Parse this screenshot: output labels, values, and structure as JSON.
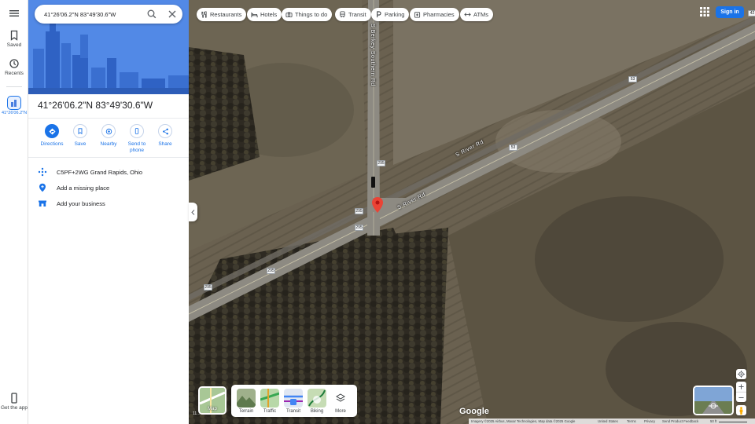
{
  "search": {
    "value": "41°26'06.2\"N 83°49'30.6\"W"
  },
  "rail": {
    "saved": "Saved",
    "recents": "Recents",
    "place_label": "41°26'06.2\"N",
    "get_app": "Get the app"
  },
  "place": {
    "title": "41°26'06.2\"N 83°49'30.6\"W",
    "actions": [
      {
        "label": "Directions",
        "icon": "directions-icon"
      },
      {
        "label": "Save",
        "icon": "bookmark-icon"
      },
      {
        "label": "Nearby",
        "icon": "nearby-icon"
      },
      {
        "label": "Send to phone",
        "icon": "phone-icon"
      },
      {
        "label": "Share",
        "icon": "share-icon"
      }
    ],
    "plus_code": "C5PF+2WG Grand Rapids, Ohio",
    "add_missing": "Add a missing place",
    "add_business": "Add your business"
  },
  "chips": [
    {
      "label": "Restaurants",
      "icon": "restaurant-icon"
    },
    {
      "label": "Hotels",
      "icon": "hotel-icon"
    },
    {
      "label": "Things to do",
      "icon": "camera-icon"
    },
    {
      "label": "Transit",
      "icon": "transit-icon"
    },
    {
      "label": "Parking",
      "icon": "parking-icon"
    },
    {
      "label": "Pharmacies",
      "icon": "pharmacy-icon"
    },
    {
      "label": "ATMs",
      "icon": "atm-icon"
    }
  ],
  "header": {
    "sign_in": "Sign in"
  },
  "map_labels": {
    "road_vertical": "S Berkey Southern Rd",
    "road_diagonal_1": "S River Rd",
    "road_diagonal_2": "S River Rd",
    "shields": [
      "53",
      "53",
      "295",
      "53",
      "295",
      "295",
      "295",
      "295",
      "42"
    ]
  },
  "layers": {
    "toggle_label": "Map",
    "items": [
      "Terrain",
      "Traffic",
      "Transit",
      "Biking",
      "More"
    ]
  },
  "scale_left": "11...",
  "footer": {
    "google": "Google",
    "imagery": "Imagery ©2025 Airbus, Maxar Technologies, Map data ©2025 Google",
    "country": "United States",
    "terms": "Terms",
    "privacy": "Privacy",
    "feedback": "Send Product Feedback",
    "scale": "50 ft"
  }
}
